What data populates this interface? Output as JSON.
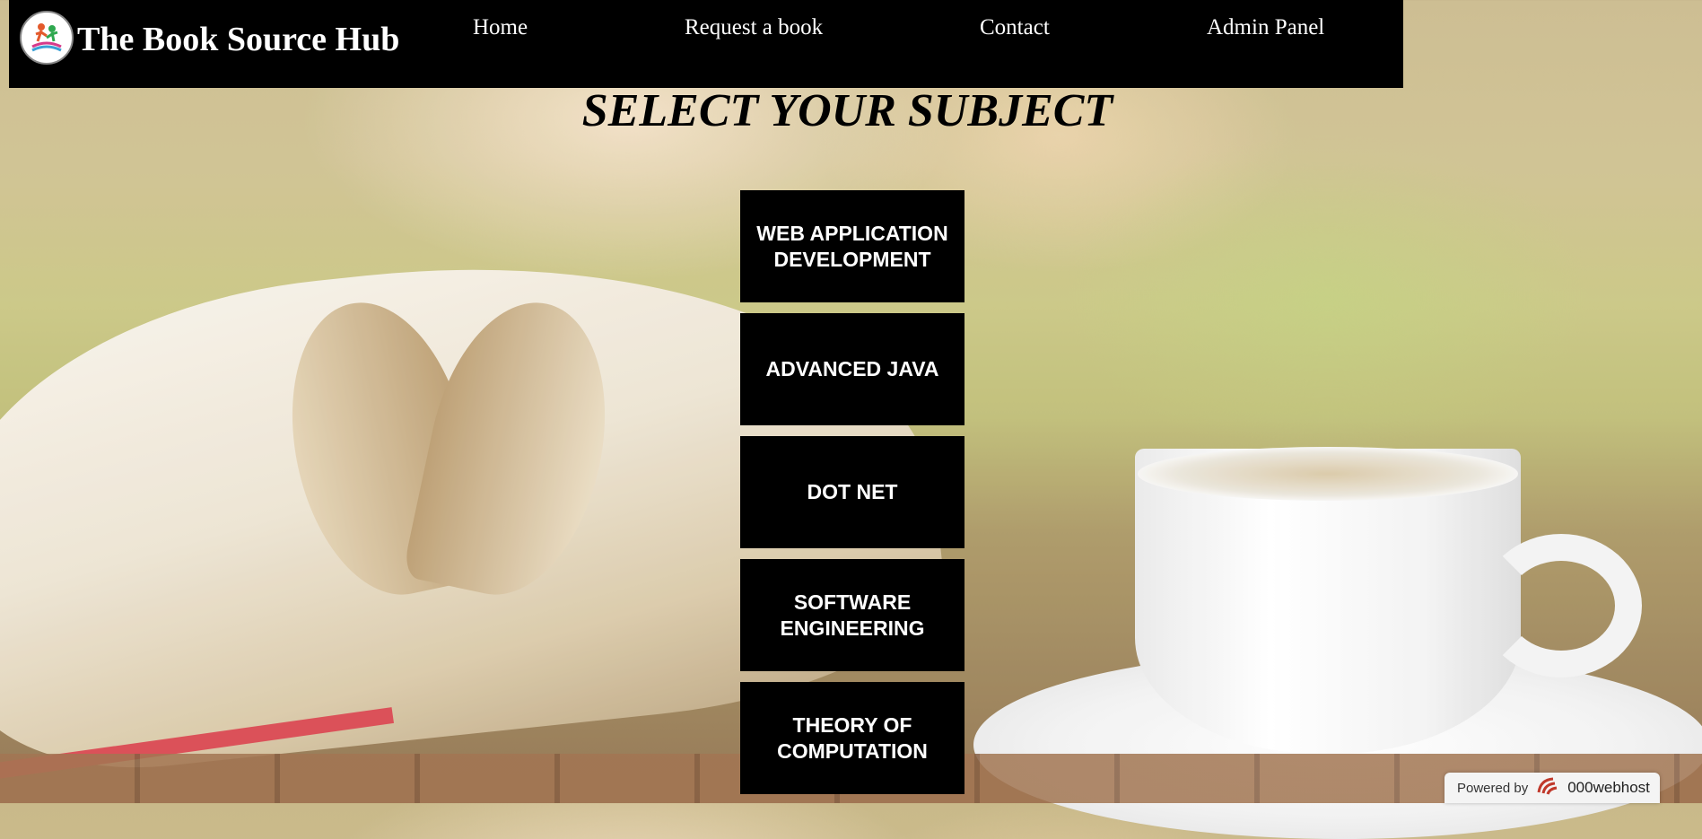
{
  "header": {
    "site_title": "The Book Source Hub",
    "nav": [
      {
        "label": "Home"
      },
      {
        "label": "Request a book"
      },
      {
        "label": "Contact"
      },
      {
        "label": "Admin Panel"
      }
    ]
  },
  "main": {
    "heading": "SELECT YOUR SUBJECT",
    "subjects": [
      {
        "label": "WEB APPLICATION DEVELOPMENT"
      },
      {
        "label": "ADVANCED JAVA"
      },
      {
        "label": "DOT NET"
      },
      {
        "label": "SOFTWARE ENGINEERING"
      },
      {
        "label": "THEORY OF COMPUTATION"
      }
    ]
  },
  "footer_badge": {
    "prefix": "Powered by",
    "brand": "000webhost"
  },
  "colors": {
    "navbar": "#000000",
    "button": "#000000",
    "button_text": "#ffffff",
    "brand_logo": "#c0392b"
  },
  "icons": [
    "site-logo-icon",
    "webhost-logo-icon"
  ]
}
